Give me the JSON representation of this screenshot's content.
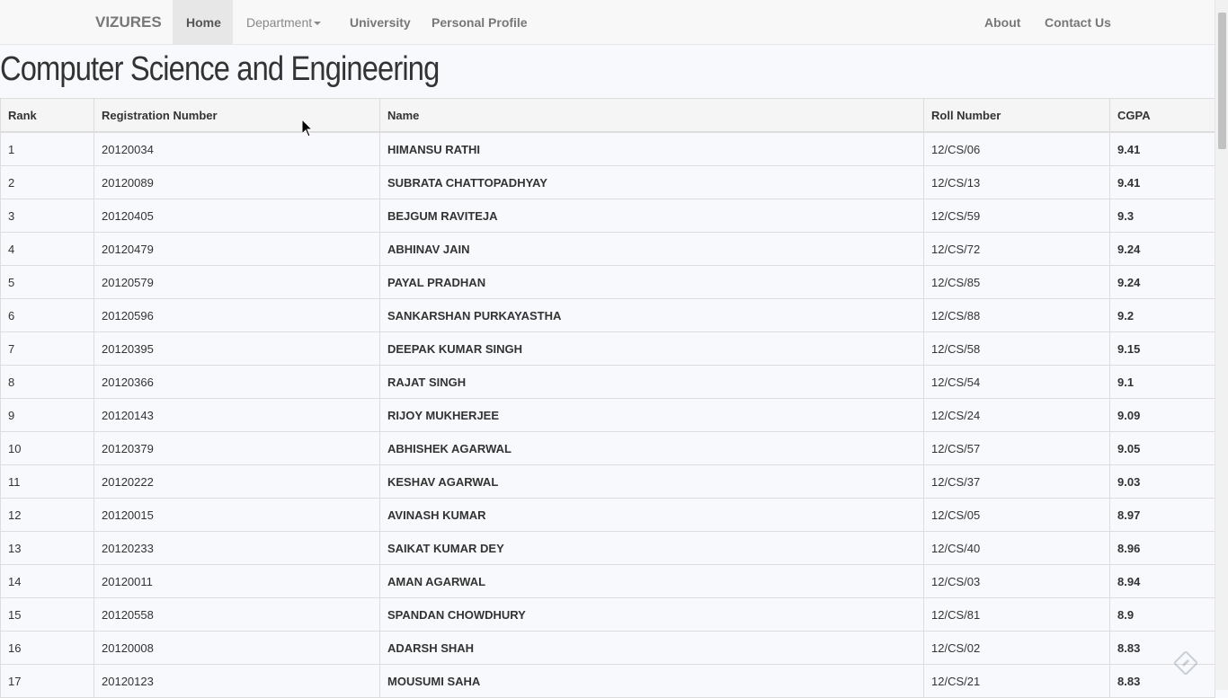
{
  "navbar": {
    "brand": "VIZURES",
    "items": [
      {
        "label": "Home",
        "active": true
      },
      {
        "label": "Department",
        "dropdown": true
      },
      {
        "label": "University"
      },
      {
        "label": "Personal Profile"
      }
    ],
    "right_items": [
      {
        "label": "About"
      },
      {
        "label": "Contact Us"
      }
    ]
  },
  "page": {
    "title": "Computer Science and Engineering"
  },
  "table": {
    "headers": [
      "Rank",
      "Registration Number",
      "Name",
      "Roll Number",
      "CGPA"
    ],
    "rows": [
      [
        "1",
        "20120034",
        "HIMANSU RATHI",
        "12/CS/06",
        "9.41"
      ],
      [
        "2",
        "20120089",
        "SUBRATA CHATTOPADHYAY",
        "12/CS/13",
        "9.41"
      ],
      [
        "3",
        "20120405",
        "BEJGUM RAVITEJA",
        "12/CS/59",
        "9.3"
      ],
      [
        "4",
        "20120479",
        "ABHINAV JAIN",
        "12/CS/72",
        "9.24"
      ],
      [
        "5",
        "20120579",
        "PAYAL PRADHAN",
        "12/CS/85",
        "9.24"
      ],
      [
        "6",
        "20120596",
        "SANKARSHAN PURKAYASTHA",
        "12/CS/88",
        "9.2"
      ],
      [
        "7",
        "20120395",
        "DEEPAK KUMAR SINGH",
        "12/CS/58",
        "9.15"
      ],
      [
        "8",
        "20120366",
        "RAJAT SINGH",
        "12/CS/54",
        "9.1"
      ],
      [
        "9",
        "20120143",
        "RIJOY MUKHERJEE",
        "12/CS/24",
        "9.09"
      ],
      [
        "10",
        "20120379",
        "ABHISHEK AGARWAL",
        "12/CS/57",
        "9.05"
      ],
      [
        "11",
        "20120222",
        "KESHAV AGARWAL",
        "12/CS/37",
        "9.03"
      ],
      [
        "12",
        "20120015",
        "AVINASH KUMAR",
        "12/CS/05",
        "8.97"
      ],
      [
        "13",
        "20120233",
        "SAIKAT KUMAR DEY",
        "12/CS/40",
        "8.96"
      ],
      [
        "14",
        "20120011",
        "AMAN AGARWAL",
        "12/CS/03",
        "8.94"
      ],
      [
        "15",
        "20120558",
        "SPANDAN CHOWDHURY",
        "12/CS/81",
        "8.9"
      ],
      [
        "16",
        "20120008",
        "ADARSH SHAH",
        "12/CS/02",
        "8.83"
      ],
      [
        "17",
        "20120123",
        "MOUSUMI SAHA",
        "12/CS/21",
        "8.83"
      ]
    ]
  }
}
